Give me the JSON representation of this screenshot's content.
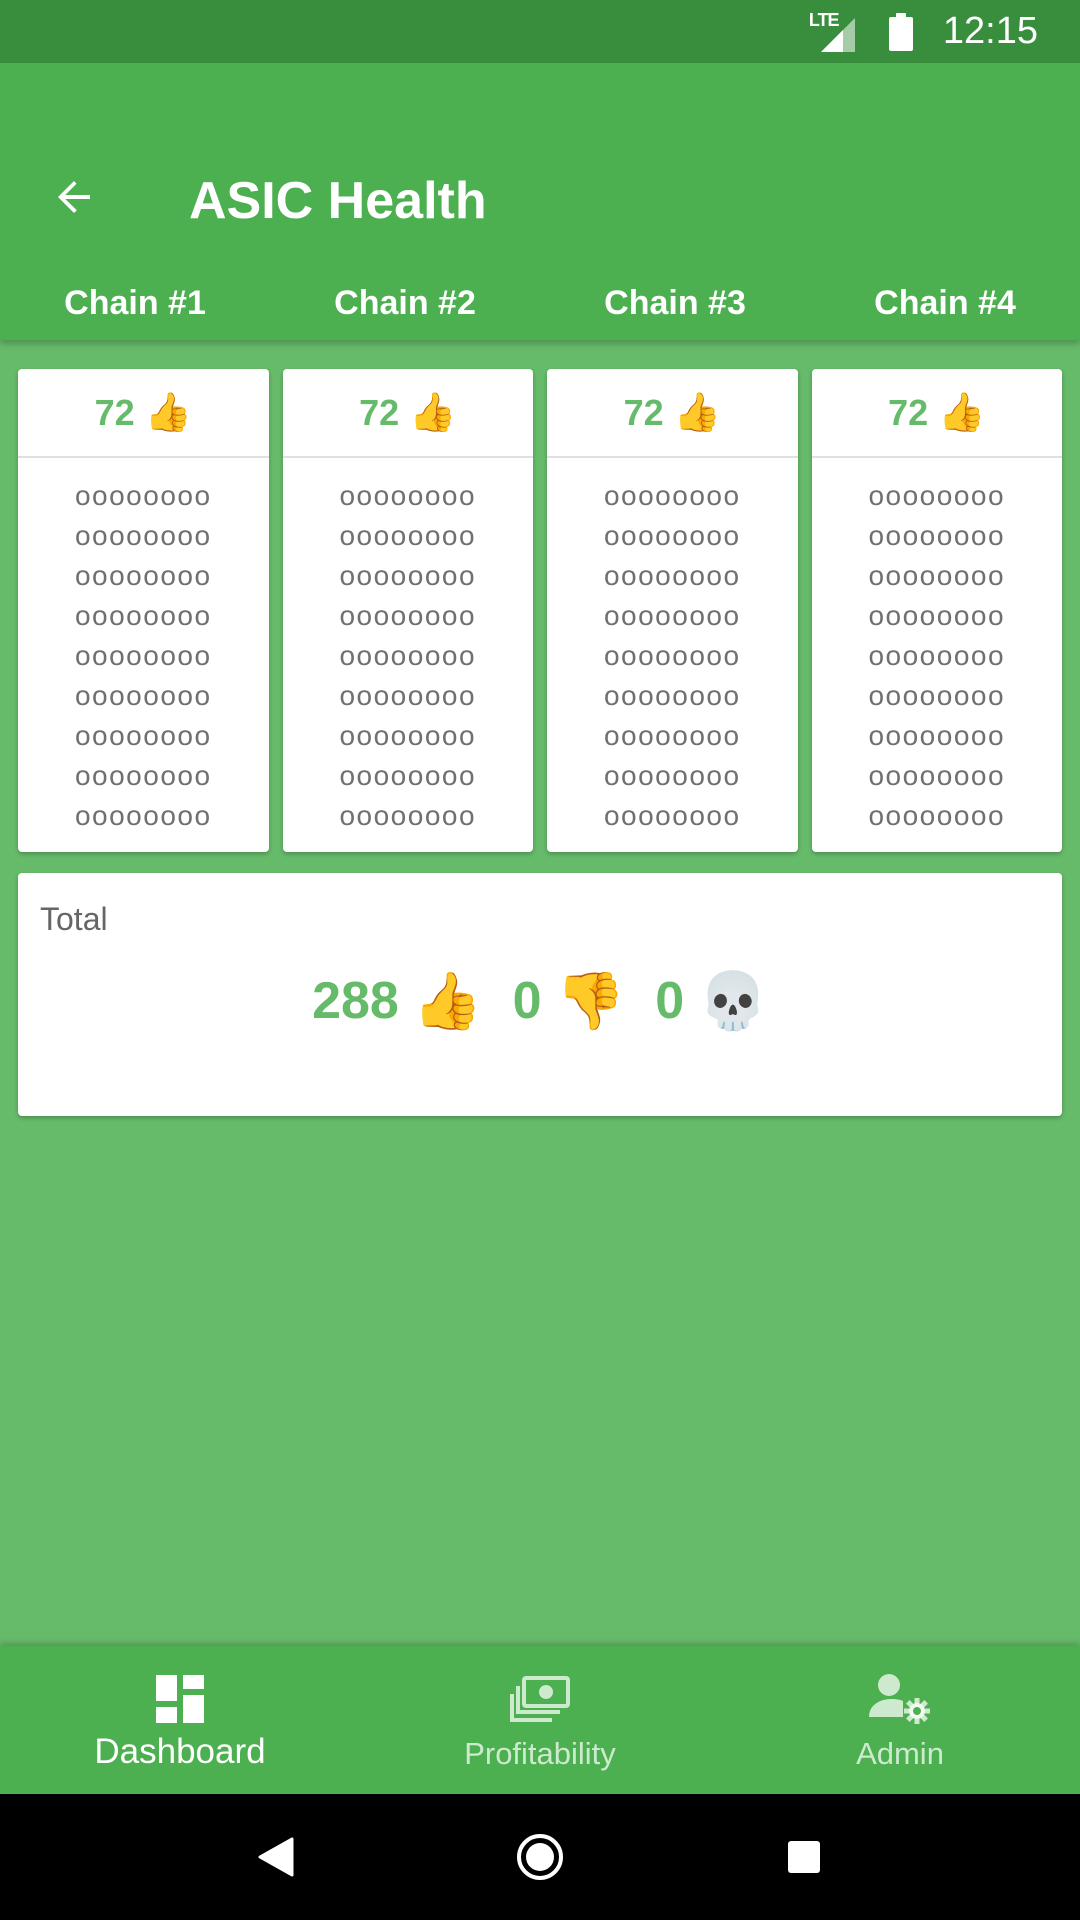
{
  "status_bar": {
    "network": "LTE",
    "time": "12:15"
  },
  "app_bar": {
    "title": "ASIC Health"
  },
  "tabs": [
    {
      "label": "Chain #1"
    },
    {
      "label": "Chain #2"
    },
    {
      "label": "Chain #3"
    },
    {
      "label": "Chain #4"
    }
  ],
  "chains": [
    {
      "ok_count": "72",
      "ok_emoji": "👍",
      "rows": [
        "oooooooo",
        "oooooooo",
        "oooooooo",
        "oooooooo",
        "oooooooo",
        "oooooooo",
        "oooooooo",
        "oooooooo",
        "oooooooo"
      ]
    },
    {
      "ok_count": "72",
      "ok_emoji": "👍",
      "rows": [
        "oooooooo",
        "oooooooo",
        "oooooooo",
        "oooooooo",
        "oooooooo",
        "oooooooo",
        "oooooooo",
        "oooooooo",
        "oooooooo"
      ]
    },
    {
      "ok_count": "72",
      "ok_emoji": "👍",
      "rows": [
        "oooooooo",
        "oooooooo",
        "oooooooo",
        "oooooooo",
        "oooooooo",
        "oooooooo",
        "oooooooo",
        "oooooooo",
        "oooooooo"
      ]
    },
    {
      "ok_count": "72",
      "ok_emoji": "👍",
      "rows": [
        "oooooooo",
        "oooooooo",
        "oooooooo",
        "oooooooo",
        "oooooooo",
        "oooooooo",
        "oooooooo",
        "oooooooo",
        "oooooooo"
      ]
    }
  ],
  "total": {
    "label": "Total",
    "ok": "288",
    "ok_emoji": "👍",
    "bad": "0",
    "bad_emoji": "👎",
    "dead": "0",
    "dead_emoji": "💀"
  },
  "bottom_nav": [
    {
      "label": "Dashboard",
      "icon": "dashboard-icon",
      "active": true
    },
    {
      "label": "Profitability",
      "icon": "money-icon",
      "active": false
    },
    {
      "label": "Admin",
      "icon": "admin-settings-icon",
      "active": false
    }
  ],
  "colors": {
    "status_bar": "#388e3c",
    "primary": "#4caf50",
    "background": "#66bb6a",
    "accent_text": "#66bb6a"
  }
}
